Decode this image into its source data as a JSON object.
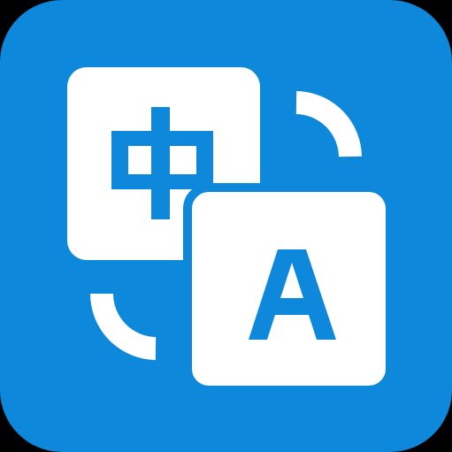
{
  "icon": {
    "name": "translate-app-icon",
    "background_color": "#0E88DA",
    "tile_color": "#FFFFFF",
    "glyph_color": "#0E88DA",
    "source_glyph": "中",
    "target_glyph": "A"
  }
}
